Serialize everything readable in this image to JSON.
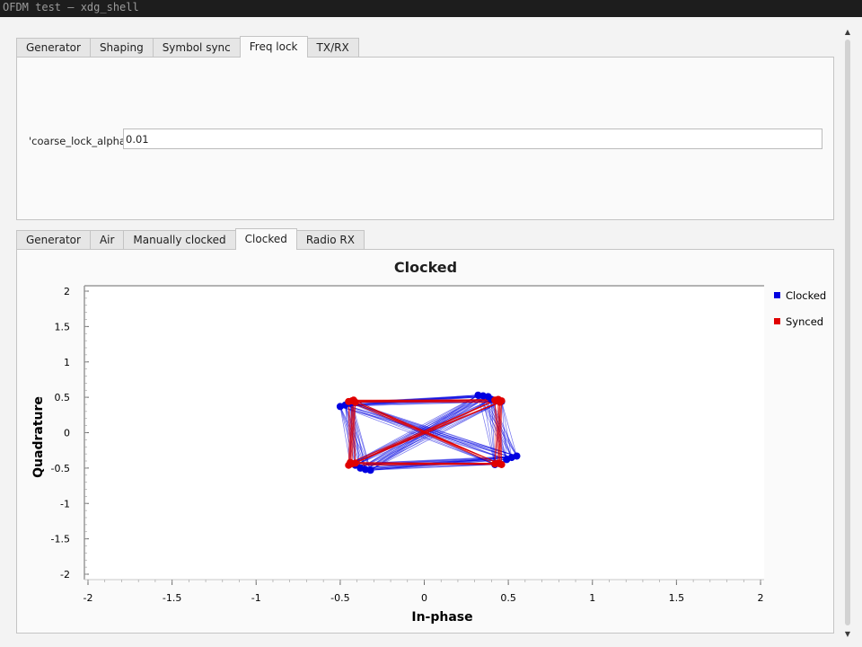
{
  "window": {
    "title": "OFDM test — xdg_shell"
  },
  "top_tabs": [
    "Generator",
    "Shaping",
    "Symbol sync",
    "Freq lock",
    "TX/RX"
  ],
  "top_active": 3,
  "freq_lock": {
    "label": "'coarse_lock_alpha':",
    "value": "0.01"
  },
  "bottom_tabs": [
    "Generator",
    "Air",
    "Manually clocked",
    "Clocked",
    "Radio RX"
  ],
  "bottom_active": 3,
  "colors": {
    "clocked": "#0000e0",
    "synced": "#e00000"
  },
  "chart_data": {
    "type": "scatter",
    "title": "Clocked",
    "xlabel": "In-phase",
    "ylabel": "Quadrature",
    "xlim": [
      -2,
      2
    ],
    "ylim": [
      -2,
      2
    ],
    "x_ticks": [
      "-2",
      "-1.5",
      "-1",
      "-0.5",
      "0",
      "0.5",
      "1",
      "1.5",
      "2"
    ],
    "y_ticks": [
      "2",
      "1.5",
      "1",
      "0.5",
      "0",
      "-0.5",
      "-1",
      "-1.5",
      "-2"
    ],
    "legend_position": "right",
    "series": [
      {
        "name": "Clocked",
        "color": "#0000e0",
        "points": [
          [
            -0.5,
            0.37
          ],
          [
            -0.47,
            0.39
          ],
          [
            -0.44,
            0.42
          ],
          [
            0.32,
            0.53
          ],
          [
            0.35,
            0.52
          ],
          [
            0.38,
            0.51
          ],
          [
            0.52,
            -0.35
          ],
          [
            0.55,
            -0.33
          ],
          [
            0.49,
            -0.38
          ],
          [
            -0.35,
            -0.52
          ],
          [
            -0.38,
            -0.5
          ],
          [
            -0.32,
            -0.53
          ],
          [
            -0.44,
            -0.44
          ],
          [
            0.46,
            0.44
          ],
          [
            0.42,
            -0.45
          ],
          [
            -0.43,
            0.43
          ],
          [
            0.4,
            0.47
          ],
          [
            -0.41,
            -0.46
          ]
        ]
      },
      {
        "name": "Synced",
        "color": "#e00000",
        "points": [
          [
            -0.45,
            0.44
          ],
          [
            -0.43,
            0.45
          ],
          [
            -0.41,
            0.43
          ],
          [
            0.42,
            0.46
          ],
          [
            0.44,
            0.47
          ],
          [
            0.46,
            0.45
          ],
          [
            0.44,
            -0.43
          ],
          [
            0.46,
            -0.45
          ],
          [
            0.42,
            -0.44
          ],
          [
            -0.43,
            -0.44
          ],
          [
            -0.45,
            -0.46
          ],
          [
            -0.41,
            -0.43
          ],
          [
            -0.44,
            -0.42
          ],
          [
            0.45,
            0.43
          ],
          [
            0.45,
            -0.44
          ],
          [
            -0.42,
            0.46
          ]
        ]
      }
    ]
  }
}
